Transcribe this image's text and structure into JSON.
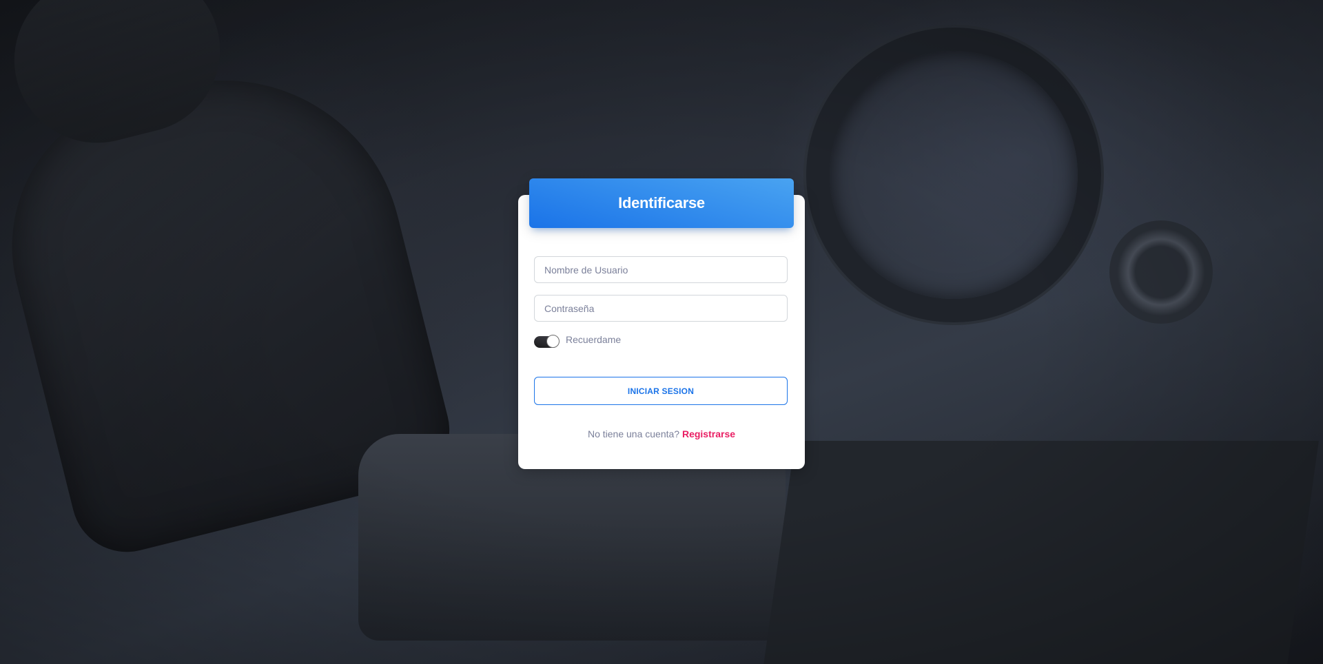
{
  "login": {
    "title": "Identificarse",
    "username_placeholder": "Nombre de Usuario",
    "password_placeholder": "Contraseña",
    "remember_label": "Recuerdame",
    "remember_checked": true,
    "submit_label": "INICIAR SESION",
    "signup_prompt": "No tiene una cuenta?",
    "signup_link": "Registrarse"
  },
  "colors": {
    "accent": "#1A73E8",
    "header_gradient_start": "#49a3f1",
    "link": "#e91e63",
    "muted_text": "#7b809a"
  }
}
